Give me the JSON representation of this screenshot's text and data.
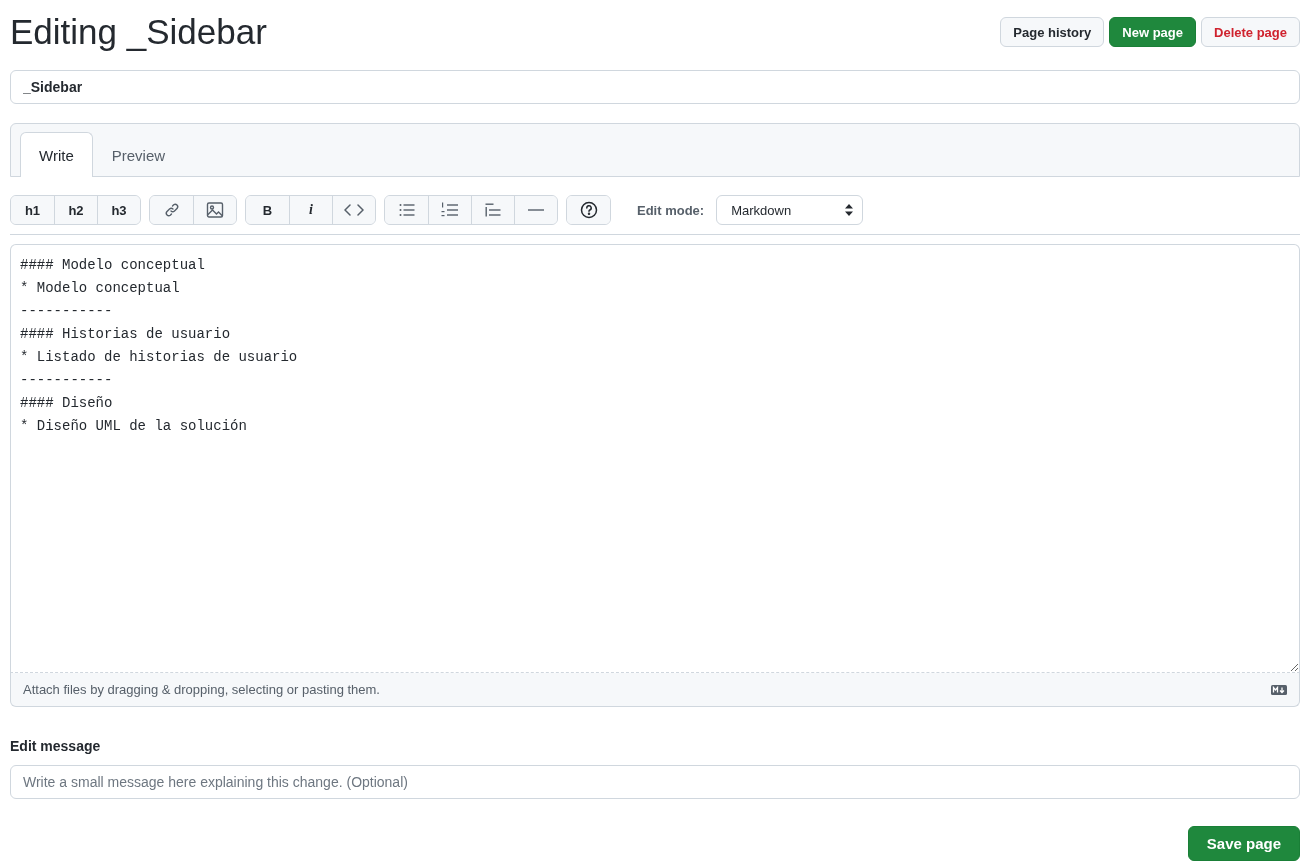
{
  "page_title": "Editing _Sidebar",
  "header_buttons": [
    {
      "label": "Page history",
      "kind": "default"
    },
    {
      "label": "New page",
      "kind": "primary"
    },
    {
      "label": "Delete page",
      "kind": "danger"
    }
  ],
  "page_name": {
    "value": "_Sidebar"
  },
  "tabs": [
    {
      "label": "Write",
      "selected": true
    },
    {
      "label": "Preview",
      "selected": false
    }
  ],
  "toolbar_groups": [
    [
      {
        "kind": "text",
        "label": "h1"
      },
      {
        "kind": "text",
        "label": "h2"
      },
      {
        "kind": "text",
        "label": "h3"
      }
    ],
    [
      {
        "kind": "link"
      },
      {
        "kind": "image"
      }
    ],
    [
      {
        "kind": "bold",
        "label": "B"
      },
      {
        "kind": "italic",
        "label": "i"
      },
      {
        "kind": "code"
      }
    ],
    [
      {
        "kind": "bullet-list"
      },
      {
        "kind": "numbered-list"
      },
      {
        "kind": "task-list"
      },
      {
        "kind": "rule"
      }
    ],
    [
      {
        "kind": "help"
      }
    ]
  ],
  "edit_mode": {
    "label": "Edit mode:",
    "value": "Markdown"
  },
  "editor_content": "#### Modelo conceptual\n* Modelo conceptual\n-----------\n#### Historias de usuario\n* Listado de historias de usuario\n-----------\n#### Diseño\n* Diseño UML de la solución",
  "attach_hint": "Attach files by dragging & dropping, selecting or pasting them.",
  "edit_message": {
    "label": "Edit message",
    "placeholder": "Write a small message here explaining this change. (Optional)"
  },
  "save_button": {
    "label": "Save page",
    "kind": "primary"
  }
}
